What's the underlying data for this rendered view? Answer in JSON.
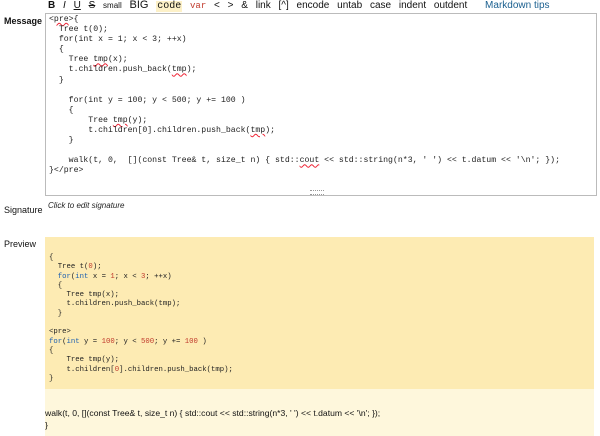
{
  "toolbar": {
    "bold": "B",
    "italic": "I",
    "underline": "U",
    "strike": "S",
    "small": "small",
    "big": "BIG",
    "code": "code",
    "var": "var",
    "lt": "<",
    "gt": ">",
    "amp": "&",
    "link": "link",
    "footnote": "[^]",
    "encode": "encode",
    "untab": "untab",
    "case": "case",
    "indent": "indent",
    "outdent": "outdent",
    "tips": "Markdown tips"
  },
  "labels": {
    "message": "Message",
    "signature": "Signature",
    "preview": "Preview"
  },
  "signature_hint": "Click to edit signature",
  "editor_lines": [
    "<pre>{",
    "  Tree t(0);",
    "  for(int x = 1; x < 3; ++x)",
    "  {",
    "    Tree tmp(x);",
    "    t.children.push_back(tmp);",
    "  }",
    "",
    "    for(int y = 100; y < 500; y += 100 )",
    "    {",
    "        Tree tmp(y);",
    "        t.children[0].children.push_back(tmp);",
    "    }",
    "",
    "    walk(t, 0,  [](const Tree& t, size_t n) { std::cout << std::string(n*3, ' ') << t.datum << '\\n'; });",
    "}</pre>"
  ],
  "preview_code_lines": [
    "{",
    "  Tree t(0);",
    "  for(int x = 1; x < 3; ++x)",
    "  {",
    "    Tree tmp(x);",
    "    t.children.push_back(tmp);",
    "  }",
    "",
    "<pre>",
    "for(int y = 100; y < 500; y += 100 )",
    "{",
    "    Tree tmp(y);",
    "    t.children[0].children.push_back(tmp);",
    "}"
  ],
  "preview_text_lines": [
    "walk(t, 0, [](const Tree& t, size_t n) { std::cout << std::string(n*3, ' ') << t.datum << '\\n'; });",
    "}"
  ]
}
